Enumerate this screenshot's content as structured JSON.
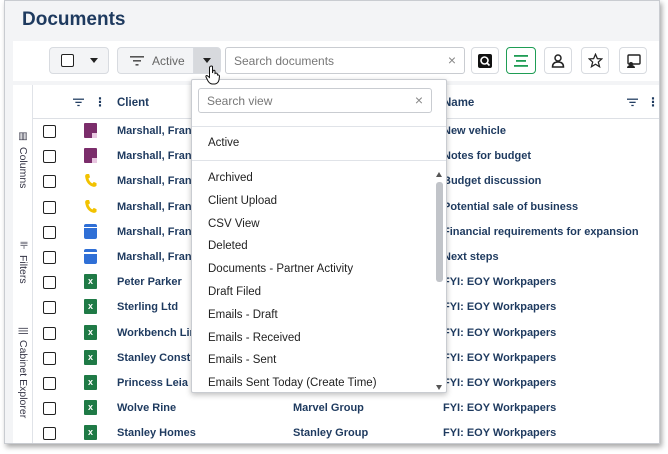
{
  "page": {
    "title": "Documents"
  },
  "toolbar": {
    "view_label": "Active",
    "search_placeholder": "Search documents",
    "clear_symbol": "×"
  },
  "side_tabs": {
    "columns": "Columns",
    "filters": "Filters",
    "cabinet_explorer": "Cabinet Explorer"
  },
  "grid": {
    "headers": {
      "client": "Client",
      "name": "Name"
    },
    "rows": [
      {
        "client": "Marshall, Frank",
        "group": "",
        "name": "New vehicle",
        "icon": "note-icon"
      },
      {
        "client": "Marshall, Frank",
        "group": "",
        "name": "Notes for budget",
        "icon": "note-icon"
      },
      {
        "client": "Marshall, Frank",
        "group": "",
        "name": "Budget discussion",
        "icon": "phone-icon"
      },
      {
        "client": "Marshall, Frank",
        "group": "",
        "name": "Potential sale of business",
        "icon": "phone-icon"
      },
      {
        "client": "Marshall, Frank",
        "group": "",
        "name": "Financial requirements for expansion",
        "icon": "calendar-icon"
      },
      {
        "client": "Marshall, Frank",
        "group": "",
        "name": "Next steps",
        "icon": "calendar-icon"
      },
      {
        "client": "Peter Parker",
        "group": "",
        "name": "FYI: EOY Workpapers",
        "icon": "excel-icon"
      },
      {
        "client": "Sterling Ltd",
        "group": "",
        "name": "FYI: EOY Workpapers",
        "icon": "excel-icon"
      },
      {
        "client": "Workbench Lim",
        "group": "",
        "name": "FYI: EOY Workpapers",
        "icon": "excel-icon"
      },
      {
        "client": "Stanley Constru",
        "group": "",
        "name": "FYI: EOY Workpapers",
        "icon": "excel-icon"
      },
      {
        "client": "Princess Leia O",
        "group": "",
        "name": "FYI: EOY Workpapers",
        "icon": "excel-icon"
      },
      {
        "client": "Wolve Rine",
        "group": "Marvel Group",
        "name": "FYI: EOY Workpapers",
        "icon": "excel-icon"
      },
      {
        "client": "Stanley Homes",
        "group": "Stanley Group",
        "name": "FYI: EOY Workpapers",
        "icon": "excel-icon"
      }
    ]
  },
  "dropdown": {
    "search_placeholder": "Search view",
    "clear_symbol": "×",
    "pinned": "Active",
    "items": [
      "Archived",
      "Client Upload",
      "CSV View",
      "Deleted",
      "Documents - Partner Activity",
      "Draft Filed",
      "Emails - Draft",
      "Emails - Received",
      "Emails - Sent",
      "Emails Sent Today (Create Time)"
    ]
  },
  "colors": {
    "accent_green": "#1f9d55",
    "title_navy": "#1e3a5f",
    "excel_green": "#1f7a46",
    "note_purple": "#7b2d6b",
    "phone_yellow": "#f2c200",
    "calendar_blue": "#2f6fd6"
  }
}
